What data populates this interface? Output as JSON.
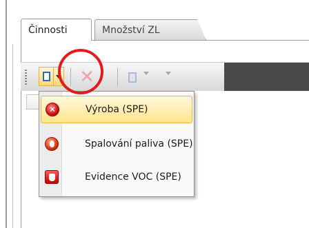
{
  "tabs": [
    {
      "label": "Činnosti"
    },
    {
      "label": "Množství ZL"
    }
  ],
  "toolbar": {
    "new_icon": "page-icon",
    "delete_icon": "delete-icon",
    "copy_icon": "copy-icon"
  },
  "menu": {
    "items": [
      {
        "label": "Výroba (SPE)",
        "icon": "red-x-circle-icon"
      },
      {
        "label": "Spalování paliva (SPE)",
        "icon": "flame-icon"
      },
      {
        "label": "Evidence VOC (SPE)",
        "icon": "red-hand-icon"
      }
    ]
  },
  "colors": {
    "highlight_circle": "#e31a1a",
    "hover_bg": "#ffe48a"
  }
}
